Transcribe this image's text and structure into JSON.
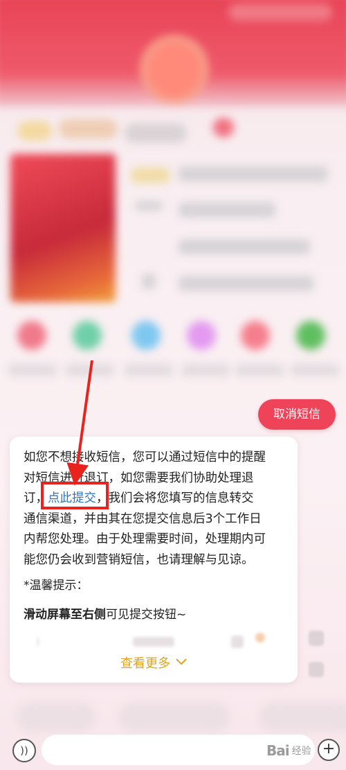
{
  "chat": {
    "cancel_chip": "取消短信",
    "message_rows": [
      "如您不想接收短信，您可以通过短信中的提醒",
      "对短信进行退订，如您需要我们协助处理退",
      "订，",
      "，我们会将您填写的信息转交",
      "通信渠道，并由其在您提交信息后3个工作日",
      "内帮您处理。由于处理需要时间，处理期内可",
      "能您仍会收到营销短信，也请理解与见谅。"
    ],
    "submit_link": "点此提交",
    "tip_title": "*温馨提示：",
    "hint_bold": "滑动屏幕至右侧",
    "hint_rest": "可见提交按钮~",
    "blurred_row": "留条表单",
    "more_label": "查看更多",
    "more_icon": "chevron-down-icon"
  },
  "colors": {
    "accent_red": "#ee4358",
    "link_blue": "#2e73c2",
    "more_gold": "#e0a31f",
    "annotation_red": "#e8231e"
  },
  "input_bar": {
    "voice_icon": "voice-icon",
    "voice_glyph": "))",
    "plus_icon": "plus-icon",
    "plus_glyph": "+"
  },
  "watermark": {
    "logo": "Bai",
    "sub": "经验"
  }
}
